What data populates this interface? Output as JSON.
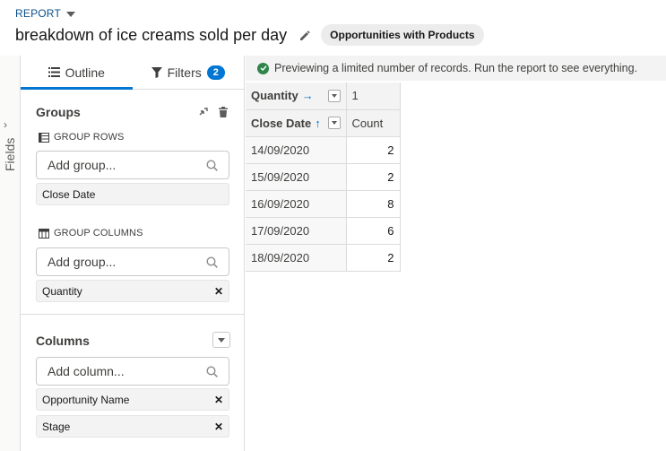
{
  "header": {
    "report_label": "REPORT",
    "title": "breakdown of ice creams sold per day",
    "report_type": "Opportunities with Products"
  },
  "fields_tab": {
    "label": "Fields"
  },
  "panel": {
    "tabs": [
      {
        "label": "Outline",
        "icon": "list-icon"
      },
      {
        "label": "Filters",
        "icon": "filter-icon",
        "badge": "2"
      }
    ],
    "groups": {
      "title": "Groups",
      "group_rows_label": "GROUP ROWS",
      "group_rows_placeholder": "Add group...",
      "group_rows": [
        "Close Date"
      ],
      "group_columns_label": "GROUP COLUMNS",
      "group_columns_placeholder": "Add group...",
      "group_columns": [
        "Quantity"
      ]
    },
    "columns": {
      "title": "Columns",
      "placeholder": "Add column...",
      "items": [
        "Opportunity Name",
        "Stage"
      ]
    }
  },
  "preview": {
    "banner": "Previewing a limited number of records. Run the report to see everything.",
    "col_group_header": "Quantity",
    "col_group_value": "1",
    "row_group_header": "Close Date",
    "measure_header": "Count",
    "rows": [
      {
        "date": "14/09/2020",
        "count": "2"
      },
      {
        "date": "15/09/2020",
        "count": "2"
      },
      {
        "date": "16/09/2020",
        "count": "8"
      },
      {
        "date": "17/09/2020",
        "count": "6"
      },
      {
        "date": "18/09/2020",
        "count": "2"
      }
    ]
  },
  "colors": {
    "accent": "#0176d3",
    "success": "#2e844a",
    "report_label": "#0b4f8a"
  }
}
